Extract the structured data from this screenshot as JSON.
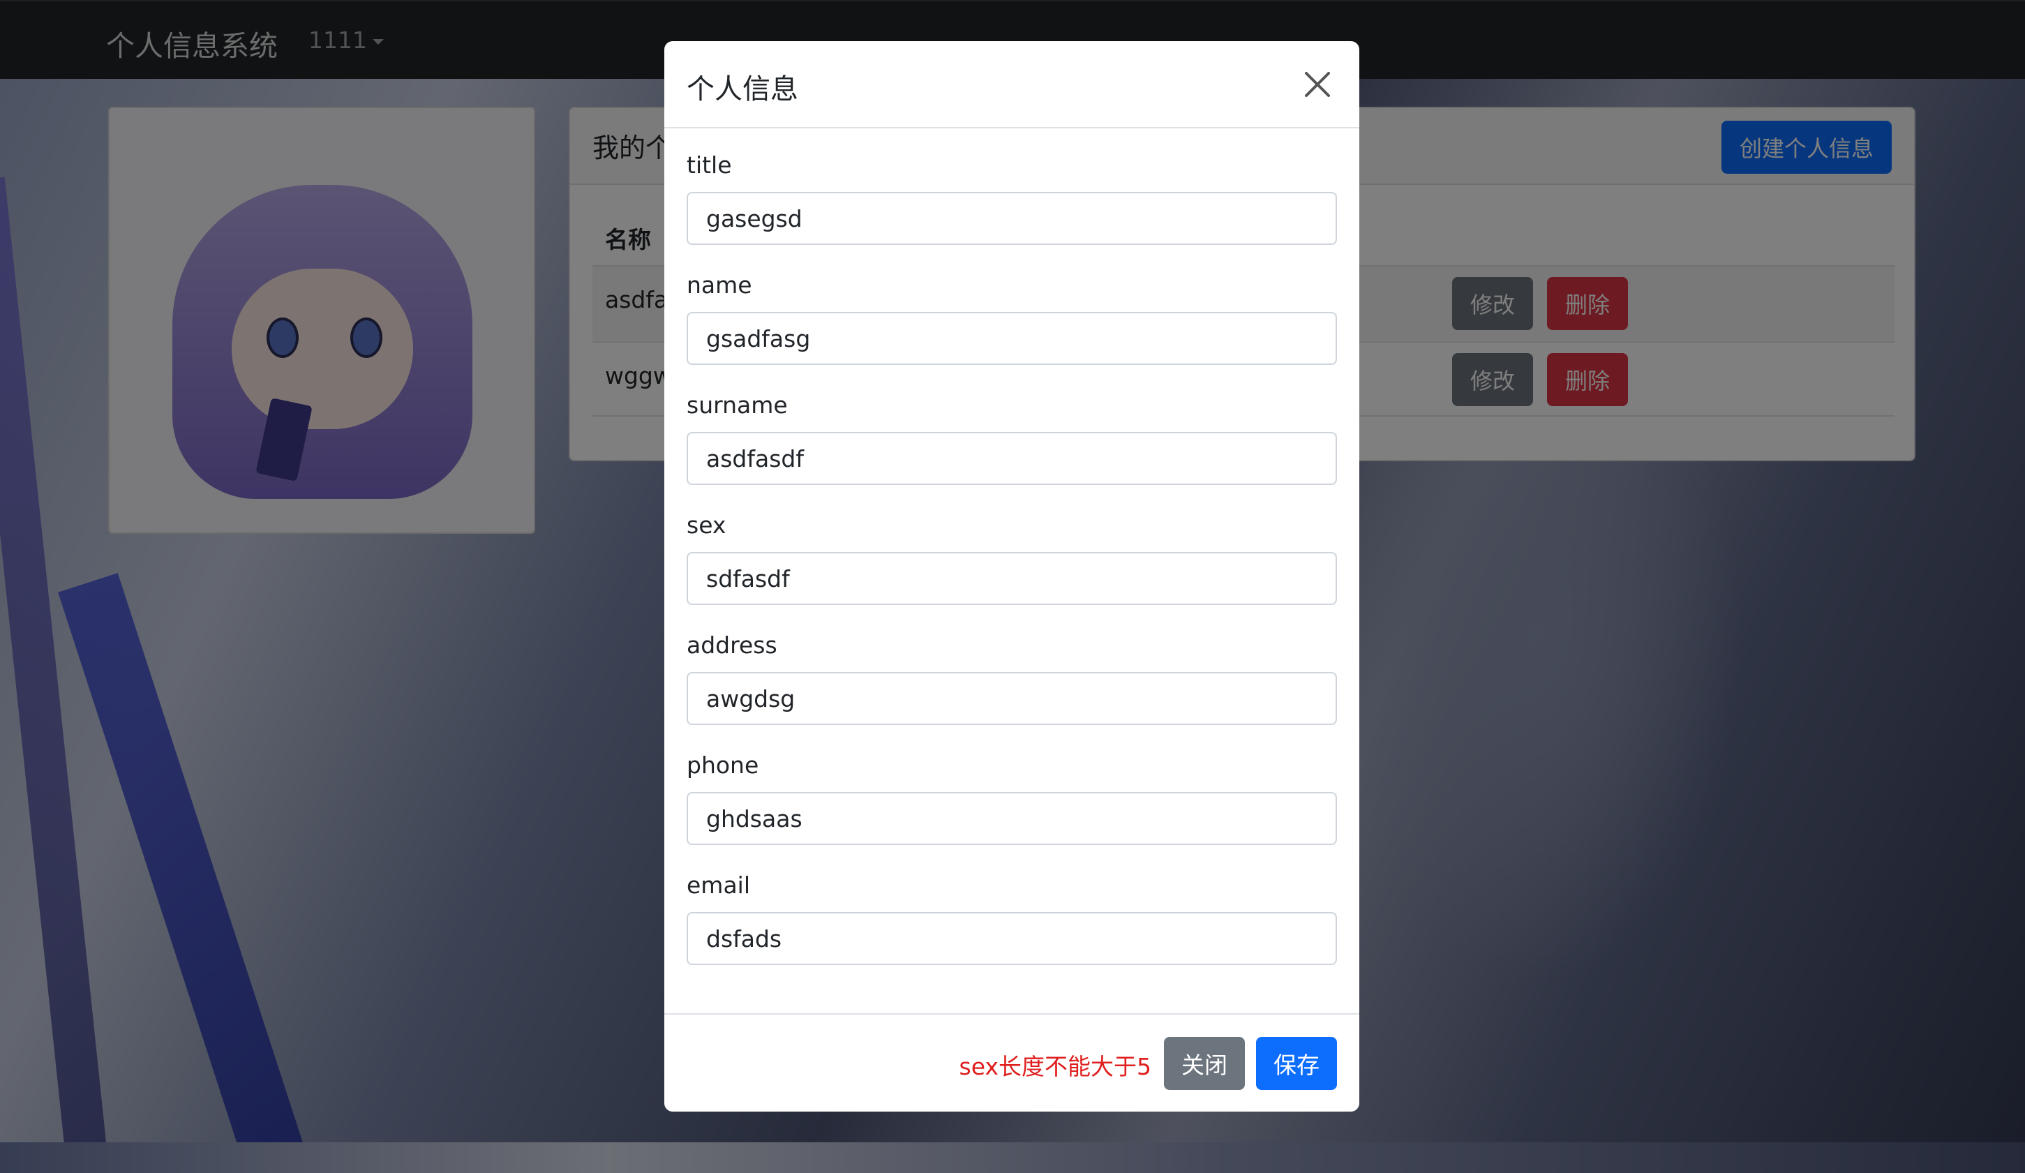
{
  "navbar": {
    "brand": "个人信息系统",
    "user": "1111"
  },
  "main_card": {
    "title": "我的个人信息",
    "create_button": "创建个人信息",
    "column_header": "名称",
    "rows": [
      {
        "name": "asdfasd",
        "edit": "修改",
        "delete": "删除"
      },
      {
        "name": "wggwg",
        "edit": "修改",
        "delete": "删除"
      }
    ]
  },
  "modal": {
    "title": "个人信息",
    "fields": [
      {
        "label": "title",
        "value": "gasegsd"
      },
      {
        "label": "name",
        "value": "gsadfasg"
      },
      {
        "label": "surname",
        "value": "asdfasdf"
      },
      {
        "label": "sex",
        "value": "sdfasdf"
      },
      {
        "label": "address",
        "value": "awgdsg"
      },
      {
        "label": "phone",
        "value": "ghdsaas"
      },
      {
        "label": "email",
        "value": "dsfads"
      }
    ],
    "error": "sex长度不能大于5",
    "close_button": "关闭",
    "save_button": "保存"
  },
  "colors": {
    "primary": "#0d6efd",
    "secondary": "#6c757d",
    "danger": "#dc3545",
    "error_text": "#e01e1e",
    "navbar": "#212529"
  },
  "icons": {
    "close": "close-icon",
    "dropdown": "caret-icon"
  }
}
